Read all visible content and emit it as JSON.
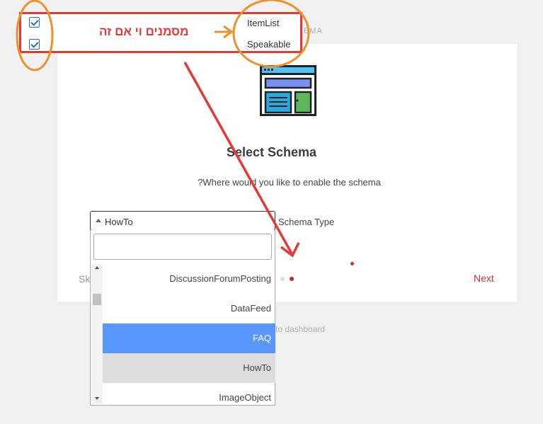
{
  "header": {
    "faded_text": "HEMA"
  },
  "card": {
    "icon": "schema-browser-icon",
    "title": "Select Schema",
    "subtitle": "?Where would you like to enable the schema",
    "schema_type_label": "Schema Type",
    "select": {
      "value": "HowTo",
      "search_value": "",
      "options": [
        {
          "label": "DiscussionForumPosting",
          "state": "normal"
        },
        {
          "label": "DataFeed",
          "state": "normal"
        },
        {
          "label": "FAQ",
          "state": "highlighted"
        },
        {
          "label": "HowTo",
          "state": "selected"
        },
        {
          "label": "ImageObject",
          "state": "normal"
        }
      ]
    },
    "skip_label": "Sk",
    "next_label": "Next",
    "step_dots": {
      "total": 2,
      "active": 2
    }
  },
  "footer": {
    "dashboard_link": "to dashboard"
  },
  "overlay": {
    "note_text": "מסמנים וי אם זה",
    "items": [
      {
        "label": "ItemList",
        "checked": true
      },
      {
        "label": "Speakable",
        "checked": true
      }
    ]
  },
  "colors": {
    "accent_red": "#d32f2f",
    "annotation_red": "#e53935",
    "annotation_orange": "#f0902c",
    "highlight_blue": "#5897fb",
    "selected_gray": "#dddddd",
    "checkbox_blue": "#1e73be"
  }
}
